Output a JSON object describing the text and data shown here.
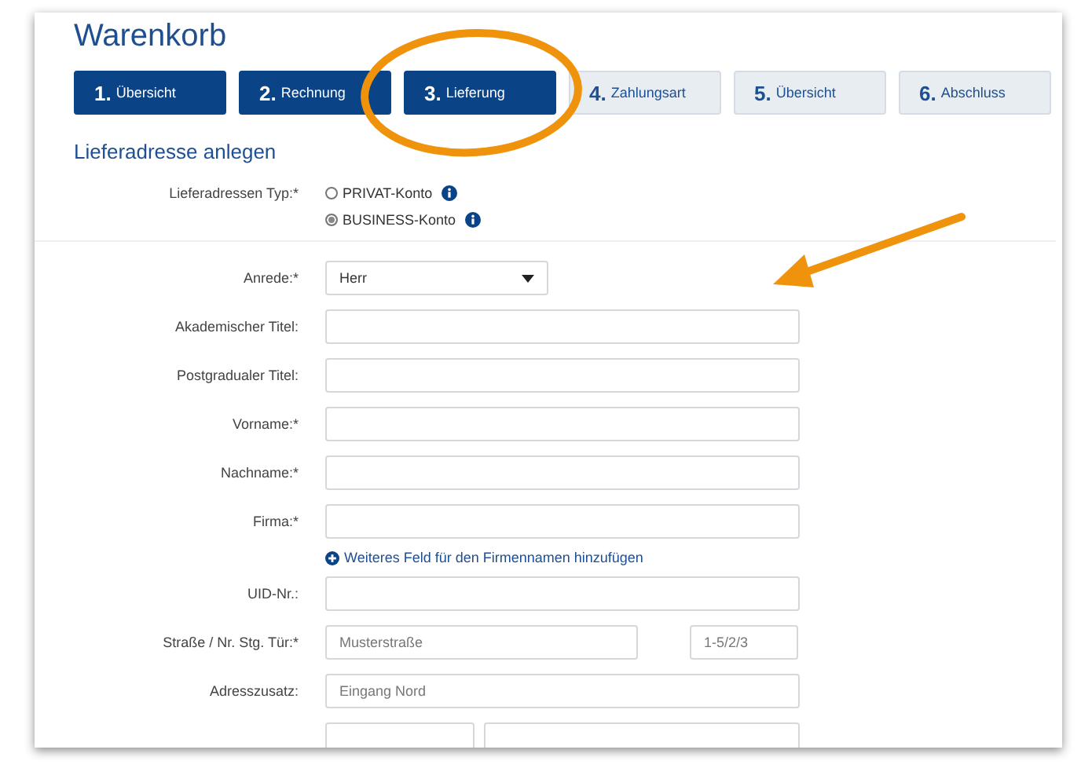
{
  "title": "Warenkorb",
  "steps": [
    {
      "number": "1.",
      "label": "Übersicht",
      "done": true
    },
    {
      "number": "2.",
      "label": "Rechnung",
      "done": true
    },
    {
      "number": "3.",
      "label": "Lieferung",
      "done": true
    },
    {
      "number": "4.",
      "label": "Zahlungsart",
      "done": false
    },
    {
      "number": "5.",
      "label": "Übersicht",
      "done": false
    },
    {
      "number": "6.",
      "label": "Abschluss",
      "done": false
    }
  ],
  "section_title": "Lieferadresse anlegen",
  "address_type": {
    "label": "Lieferadressen Typ:*",
    "options": [
      {
        "label": "PRIVAT-Konto",
        "selected": false
      },
      {
        "label": "BUSINESS-Konto",
        "selected": true
      }
    ]
  },
  "form_rows": [
    {
      "kind": "select",
      "label": "Anrede:*",
      "value": "Herr"
    },
    {
      "kind": "text",
      "label": "Akademischer Titel:"
    },
    {
      "kind": "text",
      "label": "Postgradualer Titel:"
    },
    {
      "kind": "text",
      "label": "Vorname:*"
    },
    {
      "kind": "text",
      "label": "Nachname:*"
    },
    {
      "kind": "text",
      "label": "Firma:*"
    },
    {
      "kind": "link",
      "label": "Weiteres Feld für den Firmennamen hinzufügen"
    },
    {
      "kind": "text",
      "label": "UID-Nr.:"
    },
    {
      "kind": "split",
      "label": "Straße / Nr. Stg. Tür:*",
      "placeholder": "Musterstraße",
      "placeholder_2": "1-5/2/3"
    },
    {
      "kind": "text",
      "label": "Adresszusatz:",
      "placeholder": "Eingang Nord"
    },
    {
      "kind": "split-narrow"
    }
  ]
}
